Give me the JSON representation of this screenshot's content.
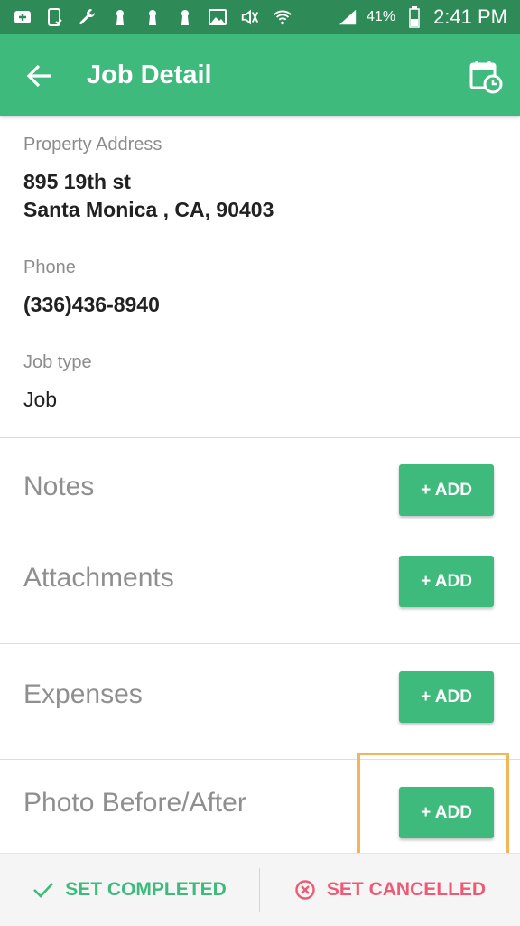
{
  "status_bar": {
    "battery": "41%",
    "time": "2:41 PM"
  },
  "app_bar": {
    "title": "Job Detail"
  },
  "details": {
    "address_label": "Property Address",
    "address_line1": "895 19th st",
    "address_line2": "Santa Monica , CA, 90403",
    "phone_label": "Phone",
    "phone_value": "(336)436-8940",
    "job_type_label": "Job type",
    "job_type_value": "Job"
  },
  "sections": {
    "notes": "Notes",
    "attachments": "Attachments",
    "expenses": "Expenses",
    "photo": "Photo Before/After",
    "add_label": "+ ADD"
  },
  "bottom_bar": {
    "completed": "SET COMPLETED",
    "cancelled": "SET CANCELLED"
  },
  "colors": {
    "status_bar": "#2e8b57",
    "app_bar": "#3dba7c",
    "button": "#3dba7c",
    "completed": "#3dba7c",
    "cancelled": "#ee5a76",
    "highlight": "#f2b55a"
  }
}
